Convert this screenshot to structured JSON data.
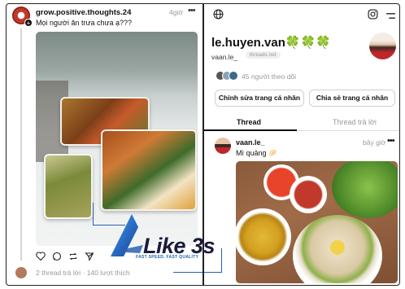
{
  "left_post": {
    "username": "grow.positive.thoughts.24",
    "time": "4giờ",
    "more": "•••",
    "caption": "Mọi người ăn trưa chưa ạ???",
    "stats": "2 thread trả lời · 140 lượt thích",
    "actions": [
      "heart-icon",
      "comment-icon",
      "repost-icon",
      "share-icon"
    ]
  },
  "watermark": {
    "brand": "Like 3s",
    "tagline": "FAST SPEED. FAST QUALITY"
  },
  "profile": {
    "name": "le.huyen.van🍀🍀🍀",
    "handle": "vaan.le_",
    "domain": "threads.net",
    "followers": "45 người theo dõi",
    "edit_button": "Chỉnh sửa trang cá nhân",
    "share_button": "Chia sẻ trang cá nhân",
    "tabs": [
      "Thread",
      "Thread trả lời"
    ]
  },
  "right_post": {
    "username": "vaan.le_",
    "time": "bây giờ",
    "more": "•••",
    "caption": "Mì quảng 🥟"
  },
  "colors": {
    "accent_blue": "#2a5fb5",
    "muted_text": "#999999"
  }
}
